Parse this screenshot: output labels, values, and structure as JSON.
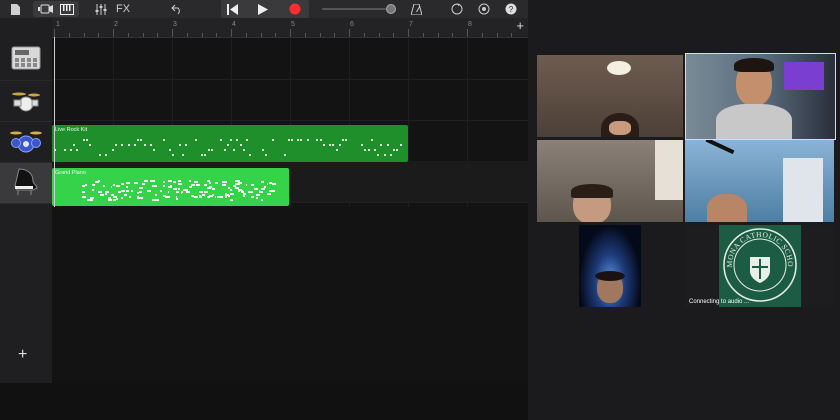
{
  "toolbar": {
    "fx_label": "FX",
    "icons": [
      "my-songs-icon",
      "browser-icon",
      "tracks-view-icon",
      "keyboard-icon",
      "mixer-icon",
      "undo-icon",
      "rewind-icon",
      "play-icon",
      "record-icon",
      "volume-slider-icon",
      "loop-icon",
      "metronome-icon",
      "settings-icon",
      "help-icon"
    ]
  },
  "ruler": {
    "bars": [
      "1",
      "2",
      "3",
      "4",
      "5",
      "6",
      "7",
      "8"
    ],
    "add_label": "+"
  },
  "tracks": [
    {
      "name": "drum-machine",
      "icon": "drum-machine-icon"
    },
    {
      "name": "drummer",
      "icon": "drummer-icon"
    },
    {
      "name": "drum-kit",
      "icon": "drum-kit-icon"
    },
    {
      "name": "grand-piano",
      "icon": "grand-piano-icon",
      "selected": true
    }
  ],
  "regions": [
    {
      "label": "Live Rock Kit",
      "color": "#1f8f2c",
      "start_bar": 1,
      "end_bar": 7.0
    },
    {
      "label": "Grand Piano",
      "color": "#34d34a",
      "start_bar": 1,
      "end_bar": 5.0
    }
  ],
  "sidebar": {
    "add_track_label": "+"
  },
  "meeting": {
    "tiles": [
      {
        "name": "participant-1"
      },
      {
        "name": "participant-2-speaking",
        "active": true
      },
      {
        "name": "participant-3"
      },
      {
        "name": "participant-4"
      },
      {
        "name": "participant-5"
      },
      {
        "name": "participant-6-logo",
        "caption": "Connecting to audio ..."
      }
    ],
    "logo_text": "POMONA CATHOLIC SCHOOL"
  },
  "colors": {
    "accent_green": "#1f8f2c",
    "bright_green": "#34d34a",
    "record_red": "#ff2d2d",
    "active_tile": "#f1e56a"
  }
}
